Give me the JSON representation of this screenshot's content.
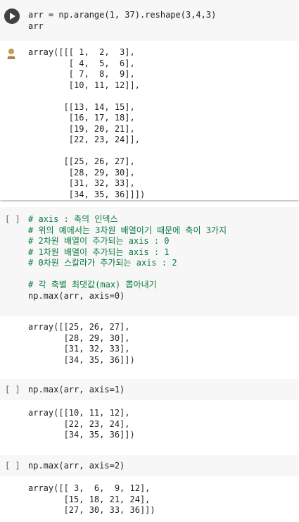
{
  "cell1": {
    "code": [
      "arr = np.arange(1, 37).reshape(3,4,3)",
      "arr"
    ],
    "output": [
      "array([[[ 1,  2,  3],",
      "        [ 4,  5,  6],",
      "        [ 7,  8,  9],",
      "        [10, 11, 12]],",
      "",
      "       [[13, 14, 15],",
      "        [16, 17, 18],",
      "        [19, 20, 21],",
      "        [22, 23, 24]],",
      "",
      "       [[25, 26, 27],",
      "        [28, 29, 30],",
      "        [31, 32, 33],",
      "        [34, 35, 36]]])"
    ]
  },
  "cell2": {
    "bracket": "[ ]",
    "code": [
      "# axis : 축의 인덱스",
      "# 위의 예에서는 3차원 배열이기 때문에 축이 3가지",
      "# 2차원 배열이 추가되는 axis : 0",
      "# 1차원 배열이 추가되는 axis : 1",
      "# 0차원 스칼라가 추가되는 axis : 2",
      "",
      "# 각 축별 최댓값(max) 뽑아내기",
      "np.max(arr, axis=0)"
    ],
    "output": [
      "array([[25, 26, 27],",
      "       [28, 29, 30],",
      "       [31, 32, 33],",
      "       [34, 35, 36]])"
    ]
  },
  "cell3": {
    "bracket": "[ ]",
    "code": "np.max(arr, axis=1)",
    "output": [
      "array([[10, 11, 12],",
      "       [22, 23, 24],",
      "       [34, 35, 36]])"
    ]
  },
  "cell4": {
    "bracket": "[ ]",
    "code": "np.max(arr, axis=2)",
    "output": [
      "array([[ 3,  6,  9, 12],",
      "       [15, 18, 21, 24],",
      "       [27, 30, 33, 36]])"
    ]
  },
  "colors": {
    "code_background": "#f7f7f7",
    "number": "#0b7a3e",
    "comment": "#0b7a3e",
    "function": "#8a2be2",
    "run_button": "#424242"
  },
  "icons": {
    "run": "run-cell-icon",
    "output": "output-avatar-icon"
  }
}
